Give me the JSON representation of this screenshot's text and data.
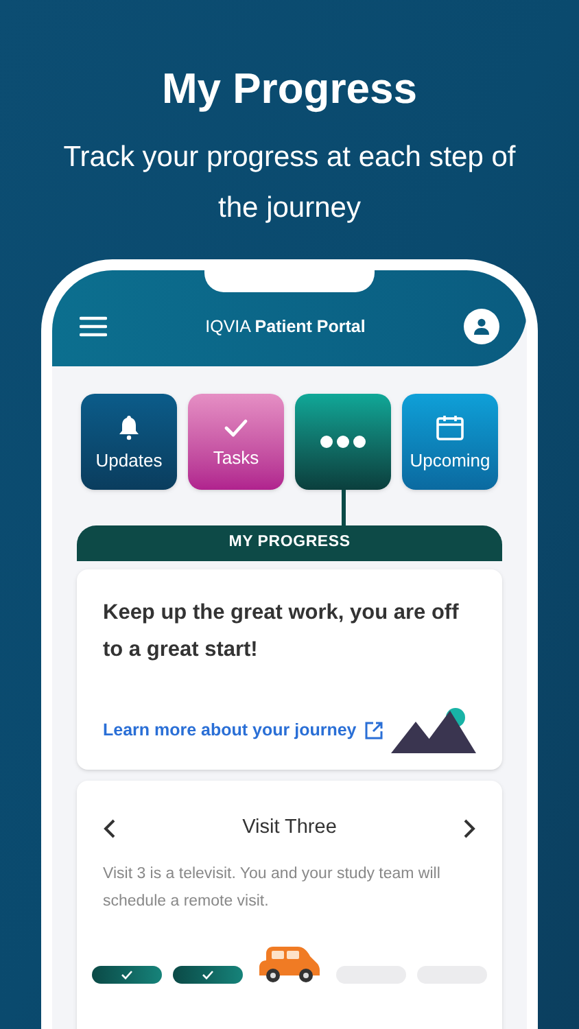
{
  "headline": "My Progress",
  "subtitle": "Track your progress at each step of the journey",
  "app_bar": {
    "brand": "IQVIA",
    "title": "Patient Portal"
  },
  "tiles": [
    {
      "kind": "updates",
      "label": "Updates",
      "selected": false
    },
    {
      "kind": "tasks",
      "label": "Tasks",
      "selected": false
    },
    {
      "kind": "more",
      "selected": true
    },
    {
      "kind": "upcoming",
      "label": "Upcoming",
      "selected": false
    }
  ],
  "section_title": "MY PROGRESS",
  "message": "Keep up the great work, you are off to a great start!",
  "link": "Learn more about your journey",
  "visit": {
    "title": "Visit Three",
    "description": "Visit 3 is a televisit. You and your study team will schedule a remote visit."
  },
  "steps": [
    {
      "kind": "done"
    },
    {
      "kind": "done"
    },
    {
      "kind": "current"
    },
    {
      "kind": "pending"
    },
    {
      "kind": "pending"
    }
  ]
}
